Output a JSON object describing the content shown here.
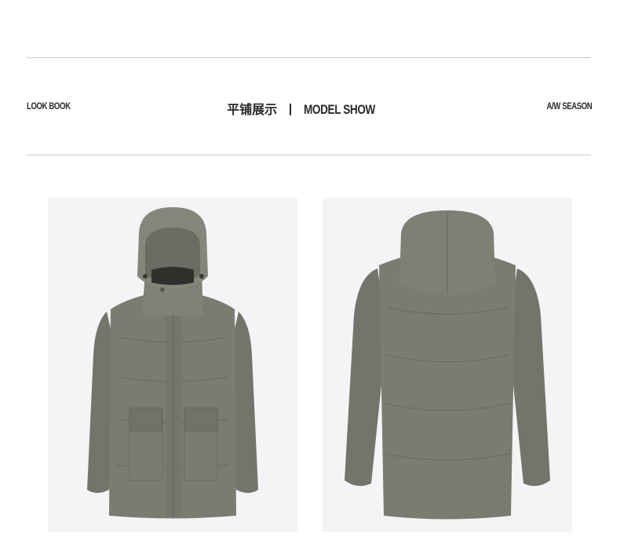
{
  "header": {
    "look_book": "LOOK BOOK",
    "title_cn": "平铺展示",
    "title_en": "MODEL SHOW",
    "season": "A/W SEASON"
  },
  "colors": {
    "jacket": "#7b7c70",
    "jacket_shadow": "#66675d",
    "jacket_highlight": "#8c8d81",
    "panel_bg": "#f3f4f6",
    "rule": "#c9c9c9"
  },
  "images": {
    "front": "hooded-down-parka-front-view",
    "back": "hooded-down-parka-back-view"
  }
}
